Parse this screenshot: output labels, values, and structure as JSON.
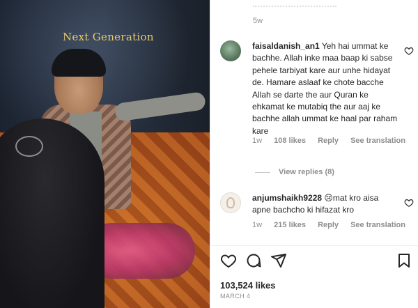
{
  "media": {
    "overlay_caption": "Next Generation"
  },
  "top": {
    "time_ago": "5w"
  },
  "comments": [
    {
      "username": "faisaldanish_an1",
      "text": "Yeh hai ummat ke bachhe. Allah inke maa baap ki sabse pehele tarbiyat kare aur unhe hidayat de. Hamare aslaaf ke chote bacche Allah se darte the aur Quran ke ehkamat ke mutabiq the aur aaj ke bachhe allah ummat ke haal par raham kare",
      "time": "1w",
      "likes": "108 likes",
      "reply_label": "Reply",
      "translate_label": "See translation",
      "view_replies": "View replies (8)"
    },
    {
      "username": "anjumshaikh9228",
      "text": "😢mat kro aisa apne bachcho ki hifazat kro",
      "time": "1w",
      "likes": "215 likes",
      "reply_label": "Reply",
      "translate_label": "See translation"
    }
  ],
  "actions": {
    "icons": [
      "heart-icon",
      "comment-icon",
      "share-icon",
      "bookmark-icon"
    ]
  },
  "post": {
    "likes": "103,524 likes",
    "date": "MARCH 4"
  },
  "colors": {
    "text": "#262626",
    "muted": "#8e8e8e",
    "caption_gold": "#e8c96a"
  }
}
